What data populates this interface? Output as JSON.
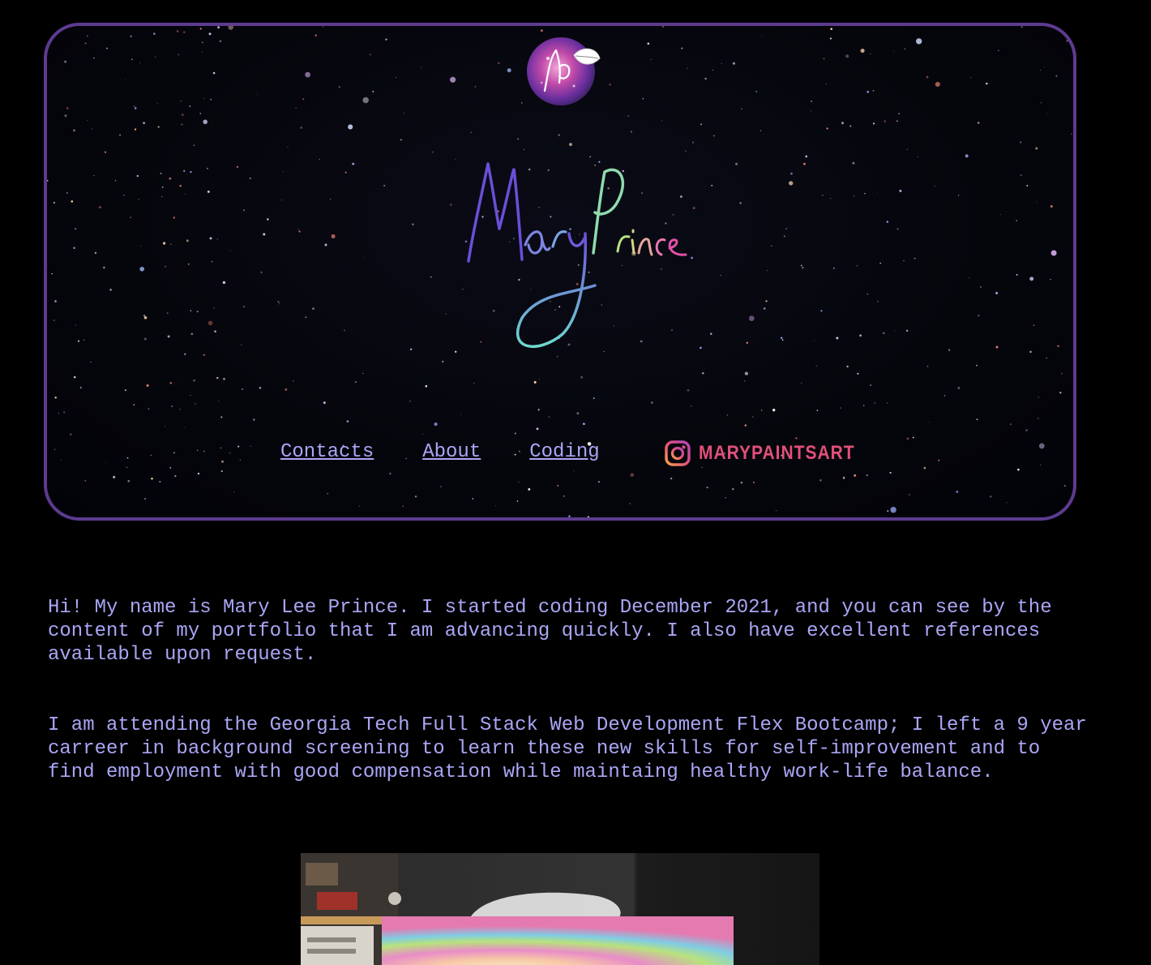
{
  "header": {
    "logo_name": "Mary Prince",
    "nav": [
      {
        "label": "Contacts"
      },
      {
        "label": "About"
      },
      {
        "label": "Coding"
      }
    ],
    "instagram": {
      "label": "MARYPAINTSART",
      "icon": "instagram-icon"
    }
  },
  "about": {
    "paragraphs": [
      "Hi! My name is Mary Lee Prince. I started coding December 2021, and you can see by the content of my portfolio that I am advancing quickly. I also have excellent references available upon request.",
      "I am attending the Georgia Tech Full Stack Web Development Flex Bootcamp; I left a 9 year carreer in background screening to learn these new skills for self-improvement and to find employment with good compensation while maintaing healthy work-life balance."
    ]
  },
  "colors": {
    "border": "#5d3b8f",
    "text": "#a9a6f5",
    "instagram": "#e2507a",
    "background": "#000000"
  }
}
